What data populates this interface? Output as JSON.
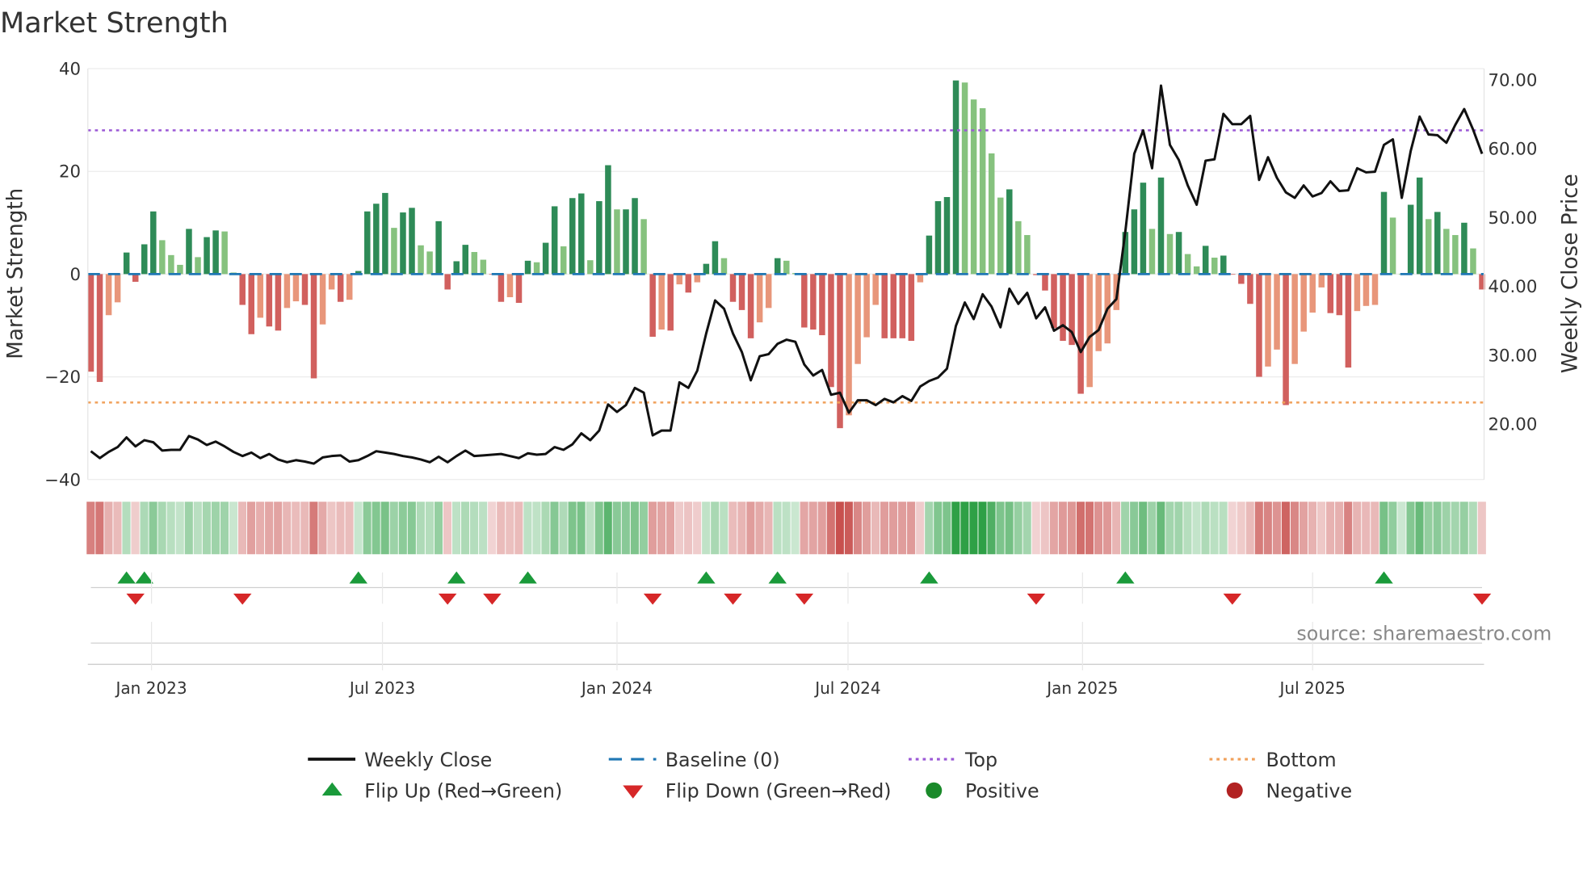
{
  "chart_data": {
    "type": "bar",
    "title": "Market Strength",
    "left_axis": {
      "label": "Market Strength",
      "ticks": [
        40,
        20,
        0,
        -20,
        -40
      ],
      "tick_labels": [
        "40",
        "20",
        "0",
        "−20",
        "−40"
      ],
      "ylim": [
        -40,
        40
      ]
    },
    "right_axis": {
      "label": "Weekly Close Price",
      "ticks": [
        70,
        60,
        50,
        40,
        30,
        20
      ],
      "tick_labels": [
        "70.00",
        "60.00",
        "50.00",
        "40.00",
        "30.00",
        "20.00"
      ],
      "ylim": [
        11.8,
        71.5
      ]
    },
    "x_ticks": [
      {
        "label": "Jan 2023",
        "week_index": 6.8
      },
      {
        "label": "Jul 2023",
        "week_index": 32.7
      },
      {
        "label": "Jan 2024",
        "week_index": 59.0
      },
      {
        "label": "Jul 2024",
        "week_index": 84.9
      },
      {
        "label": "Jan 2025",
        "week_index": 111.2
      },
      {
        "label": "Jul 2025",
        "week_index": 137.0
      }
    ],
    "top_level": 28,
    "bottom_level": -25,
    "strength": [
      -19,
      -21,
      -8,
      -5.5,
      4.2,
      -1.5,
      5.8,
      12.2,
      6.6,
      3.7,
      1.8,
      8.8,
      3.3,
      7.2,
      8.5,
      8.3,
      0.3,
      -6,
      -11.7,
      -8.5,
      -10.2,
      -11,
      -6.6,
      -5.3,
      -6,
      -20.3,
      -9.8,
      -3,
      -5.4,
      -5,
      0.6,
      12.2,
      13.7,
      15.8,
      9,
      12,
      12.9,
      5.6,
      4.4,
      10.3,
      -3,
      2.5,
      5.7,
      4.3,
      2.8,
      -0.1,
      -5.4,
      -4.5,
      -5.6,
      2.6,
      2.3,
      6.1,
      13.2,
      5.4,
      14.8,
      15.7,
      2.7,
      14.2,
      21.2,
      12.6,
      12.6,
      14.8,
      10.7,
      -12.2,
      -10.8,
      -11,
      -2,
      -3.6,
      -1.6,
      2,
      6.4,
      3.1,
      -5.4,
      -7,
      -12.5,
      -9.4,
      -6.6,
      3.1,
      2.6,
      0.2,
      -10.4,
      -10.8,
      -11.9,
      -22,
      -30,
      -27.5,
      -17.5,
      -12.3,
      -6,
      -12.5,
      -12.5,
      -12.5,
      -13,
      -1.6,
      7.5,
      14.2,
      15,
      37.7,
      37.3,
      34,
      32.3,
      23.5,
      14.9,
      16.5,
      10.3,
      7.6,
      -0.2,
      -3.2,
      -10.5,
      -13,
      -13.8,
      -23.3,
      -22,
      -15,
      -13.5,
      -7,
      8.2,
      12.6,
      17.8,
      8.8,
      18.8,
      7.8,
      8.2,
      3.9,
      1.5,
      5.5,
      3.2,
      3.6,
      -0.1,
      -1.9,
      -5.8,
      -20,
      -18,
      -14.7,
      -25.5,
      -17.5,
      -11.2,
      -7.5,
      -2.6,
      -7.6,
      -8,
      -18.2,
      -7.2,
      -6.2,
      -6,
      16,
      11,
      0,
      13.5,
      18.8,
      10.7,
      12.1,
      8.8,
      7.6,
      10,
      5,
      -3
    ],
    "close": [
      15.9,
      14.9,
      15.8,
      16.5,
      17.9,
      16.6,
      17.5,
      17.2,
      16,
      16.1,
      16.1,
      18.1,
      17.6,
      16.8,
      17.3,
      16.6,
      15.8,
      15.2,
      15.7,
      14.9,
      15.5,
      14.7,
      14.3,
      14.6,
      14.4,
      14.1,
      15,
      15.2,
      15.3,
      14.4,
      14.6,
      15.2,
      15.9,
      15.7,
      15.5,
      15.2,
      15,
      14.7,
      14.3,
      15.1,
      14.3,
      15.2,
      16,
      15.2,
      15.3,
      15.4,
      15.5,
      15.2,
      14.9,
      15.6,
      15.4,
      15.5,
      16.5,
      16.1,
      16.9,
      18.5,
      17.5,
      18.9,
      22.7,
      21.6,
      22.6,
      25.1,
      24.4,
      18.2,
      18.9,
      18.9,
      25.9,
      25.1,
      27.6,
      33,
      37.8,
      36.6,
      33,
      30.3,
      26.2,
      29.7,
      30,
      31.5,
      32.1,
      31.8,
      28.5,
      26.9,
      27.7,
      24.1,
      24.4,
      21.5,
      23.3,
      23.3,
      22.6,
      23.5,
      23,
      23.9,
      23.2,
      25.3,
      26.1,
      26.6,
      27.9,
      34.1,
      37.5,
      35.1,
      38.7,
      36.9,
      33.9,
      39.5,
      37.3,
      38.9,
      35.2,
      36.8,
      33.4,
      34.2,
      33.2,
      30.3,
      32.5,
      33.5,
      36.6,
      38,
      47.8,
      59.1,
      62.5,
      57,
      69,
      60.4,
      58.2,
      54.5,
      51.7,
      58.1,
      58.3,
      64.9,
      63.4,
      63.4,
      64.6,
      55.3,
      58.6,
      55.6,
      53.5,
      52.7,
      54.5,
      52.9,
      53.4,
      55.1,
      53.7,
      53.8,
      57,
      56.4,
      56.5,
      60.4,
      61.2,
      52.7,
      59.5,
      64.5,
      61.9,
      61.8,
      60.7,
      63.3,
      65.6,
      62.6,
      59.1
    ],
    "legend": [
      {
        "label": "Weekly Close",
        "kind": "line",
        "color": "#111111"
      },
      {
        "label": "Baseline (0)",
        "kind": "dash",
        "color": "#1f77b4"
      },
      {
        "label": "Top",
        "kind": "dot",
        "color": "#9b59d6"
      },
      {
        "label": "Bottom",
        "kind": "dot",
        "color": "#f0a05a"
      },
      {
        "label": "Flip Up (Red→Green)",
        "kind": "tri-up",
        "color": "#1a9a3a"
      },
      {
        "label": "Flip Down (Green→Red)",
        "kind": "tri-down",
        "color": "#d62728"
      },
      {
        "label": "Positive",
        "kind": "circle",
        "color": "#1a8a2a"
      },
      {
        "label": "Negative",
        "kind": "circle",
        "color": "#b22222"
      }
    ],
    "colors": {
      "pos_strong": "#2e8b57",
      "pos_weak": "#86c27e",
      "neg_strong": "#d1605e",
      "neg_weak": "#e8967a"
    }
  },
  "source": "source: sharemaestro.com"
}
